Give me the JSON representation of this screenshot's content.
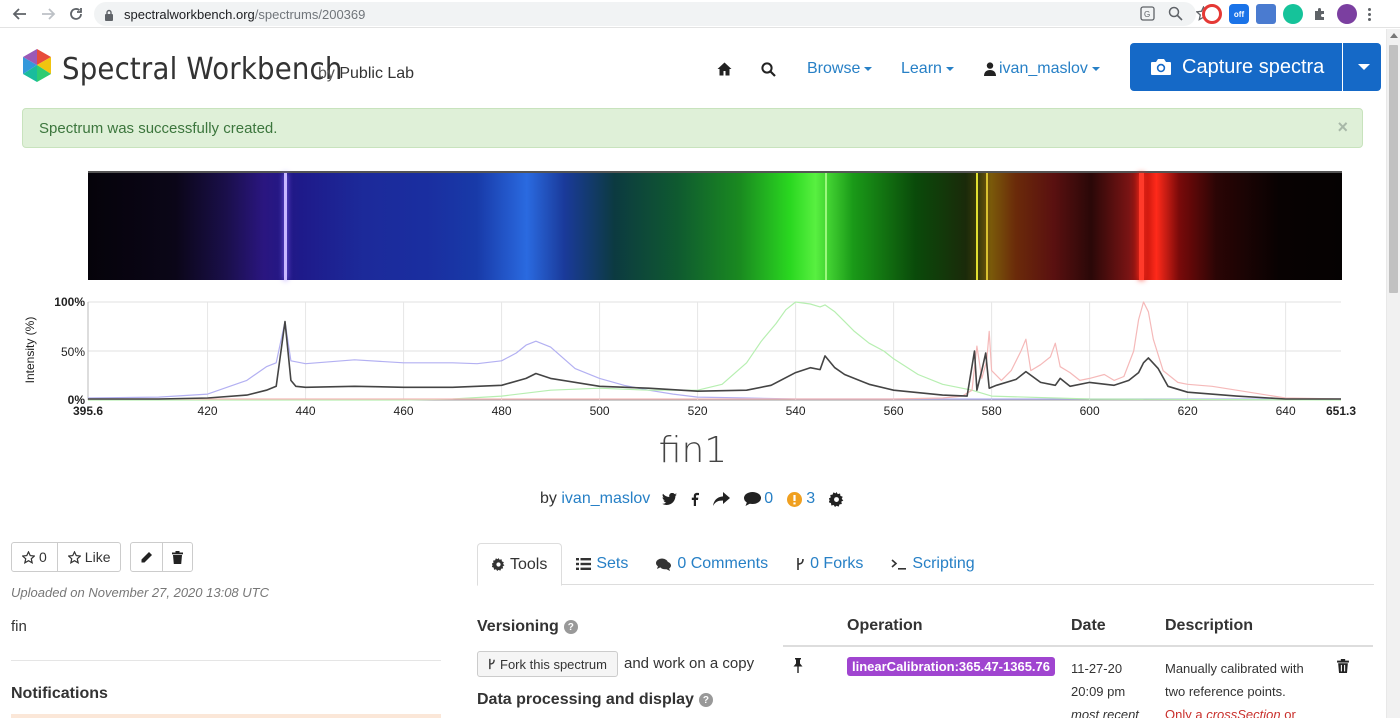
{
  "browser": {
    "url_host": "spectralworkbench.org",
    "url_path": "/spectrums/200369",
    "ext_off_label": "off"
  },
  "header": {
    "brand": "Spectral Workbench",
    "by_text": "by",
    "org": "Public Lab",
    "nav": {
      "browse": "Browse",
      "learn": "Learn",
      "user": "ivan_maslov"
    },
    "capture_label": "Capture spectra",
    "accent_color": "#1569c7",
    "link_color": "#2780c6"
  },
  "alert": {
    "message": "Spectrum was successfully created.",
    "close": "×"
  },
  "chart_data": {
    "type": "line",
    "ylabel": "Intensity (%)",
    "y_ticks": [
      "100%",
      "50%",
      "0%"
    ],
    "xlim": [
      395.6,
      651.3
    ],
    "x_ticks": [
      "420",
      "440",
      "460",
      "480",
      "500",
      "520",
      "540",
      "560",
      "580",
      "600",
      "620",
      "640"
    ],
    "x_min_label": "395.6",
    "x_max_label": "651.3",
    "ylim": [
      0,
      100
    ],
    "grid": true,
    "series": [
      {
        "color": "#444444",
        "x": [
          395.6,
          410,
          420,
          428,
          432,
          434,
          435.8,
          437,
          438,
          440,
          450,
          460,
          470,
          480,
          485,
          487,
          490,
          500,
          510,
          520,
          530,
          535,
          540,
          543,
          545,
          546,
          548,
          550,
          555,
          560,
          570,
          575,
          576.5,
          577,
          578,
          578.8,
          579.5,
          581,
          585,
          587,
          590,
          593,
          594,
          596,
          600,
          605,
          608,
          610,
          611,
          612,
          614,
          616,
          620,
          630,
          640,
          651.3
        ],
        "y": [
          1,
          1,
          2,
          5,
          10,
          14,
          80,
          20,
          14,
          13,
          14,
          13,
          13,
          15,
          22,
          27,
          22,
          14,
          12,
          9,
          10,
          15,
          28,
          33,
          31,
          45,
          33,
          26,
          16,
          10,
          5,
          4,
          50,
          10,
          30,
          48,
          12,
          15,
          21,
          29,
          18,
          15,
          22,
          14,
          18,
          15,
          20,
          28,
          38,
          43,
          32,
          14,
          8,
          4,
          1,
          1
        ]
      },
      {
        "color": "#b3b0f2",
        "x": [
          395.6,
          410,
          420,
          428,
          432,
          434,
          435.8,
          437,
          440,
          450,
          460,
          470,
          475,
          480,
          483,
          485,
          487,
          490,
          495,
          500,
          505,
          510,
          515,
          520,
          530,
          540,
          550,
          560,
          570,
          580,
          600,
          620,
          640,
          651.3
        ],
        "y": [
          2,
          3,
          6,
          20,
          34,
          38,
          80,
          40,
          37,
          41,
          38,
          38,
          37,
          40,
          48,
          56,
          60,
          54,
          32,
          22,
          15,
          10,
          6,
          3,
          2,
          1,
          1,
          1,
          1,
          1,
          1,
          1,
          1,
          1
        ]
      },
      {
        "color": "#b7efb1",
        "x": [
          395.6,
          420,
          440,
          460,
          470,
          480,
          490,
          500,
          510,
          520,
          525,
          530,
          533,
          536,
          538,
          540,
          543,
          545,
          546,
          548,
          550,
          552,
          555,
          558,
          560,
          565,
          570,
          576,
          580,
          600,
          651.3
        ],
        "y": [
          0,
          0,
          0,
          0,
          1,
          4,
          10,
          12,
          10,
          10,
          16,
          38,
          60,
          78,
          92,
          100,
          98,
          95,
          97,
          90,
          80,
          70,
          58,
          50,
          42,
          26,
          16,
          10,
          4,
          1,
          0
        ]
      },
      {
        "color": "#f5b9b9",
        "x": [
          395.6,
          520,
          560,
          570,
          574,
          576,
          577,
          578,
          579,
          579.5,
          580,
          582,
          584,
          586,
          587,
          588,
          590,
          592,
          593,
          594,
          596,
          598,
          600,
          603,
          605,
          607,
          609,
          610,
          611,
          612,
          613,
          615,
          618,
          620,
          625,
          630,
          640,
          651.3
        ],
        "y": [
          1,
          1,
          1,
          2,
          4,
          10,
          55,
          22,
          40,
          70,
          30,
          20,
          30,
          50,
          62,
          30,
          36,
          44,
          58,
          34,
          28,
          20,
          22,
          26,
          20,
          24,
          50,
          82,
          100,
          90,
          62,
          30,
          18,
          16,
          14,
          10,
          2,
          1
        ]
      }
    ]
  },
  "spectrum": {
    "title": "fin1",
    "by_label": "by",
    "author": "ivan_maslov",
    "comments_count": "0",
    "alerts_count": "3"
  },
  "left": {
    "star_count": "0",
    "like_label": "Like",
    "uploaded": "Uploaded on November 27, 2020 13:08 UTC",
    "description": "fin",
    "notifications_heading": "Notifications"
  },
  "tabs": [
    {
      "label": "Tools"
    },
    {
      "label": "Sets"
    },
    {
      "label": "0 Comments"
    },
    {
      "label": "0 Forks"
    },
    {
      "label": "Scripting"
    }
  ],
  "tools": {
    "versioning": "Versioning",
    "fork_button": "Fork this spectrum",
    "fork_after": "and work on a copy",
    "data_processing": "Data processing and display"
  },
  "operations": {
    "headers": {
      "operation": "Operation",
      "date": "Date",
      "description": "Description"
    },
    "rows": [
      {
        "operation": "linearCalibration:365.47-1365.76",
        "date_line1": "11-27-20",
        "date_line2": "20:09 pm",
        "date_line3": "most recent",
        "desc_line1": "Manually calibrated with",
        "desc_line2": "two reference points.",
        "desc_warn_prefix": "Only a ",
        "desc_warn_em": "crossSection",
        "desc_warn_suffix": " or",
        "label_color": "#a045d0"
      }
    ]
  }
}
